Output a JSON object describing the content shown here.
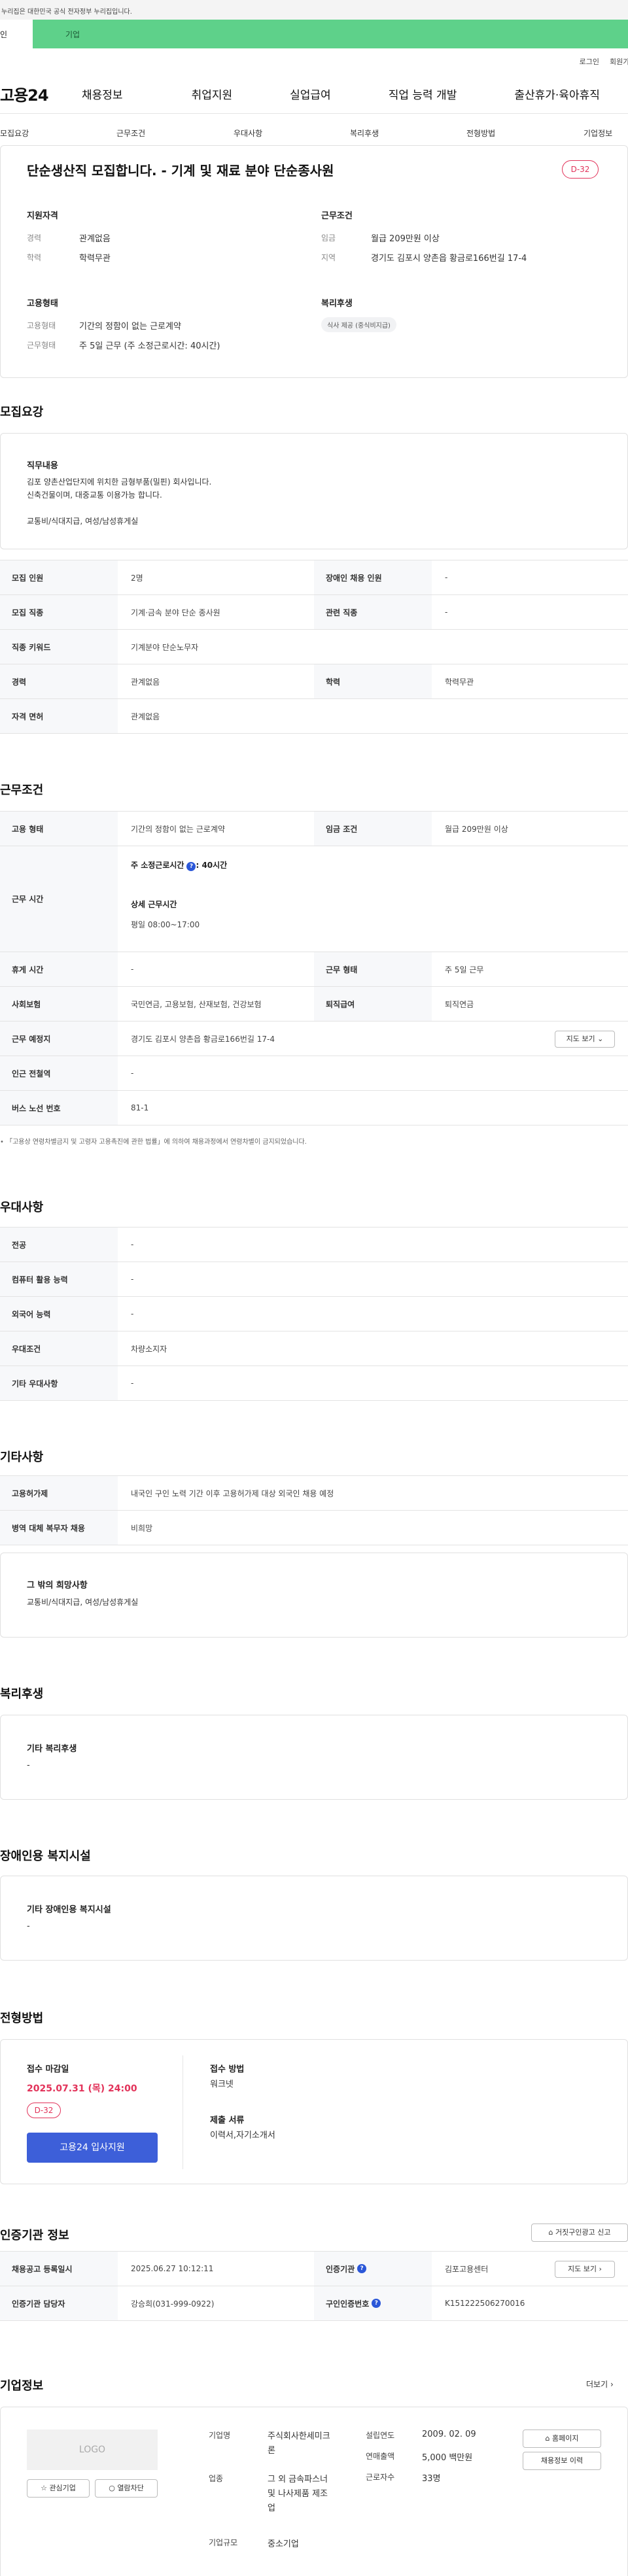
{
  "gov_notice": "누리집은 대한민국 공식 전자정부 누리집입니다.",
  "user_type": {
    "personal": "인",
    "company": "기업"
  },
  "util": {
    "login": "로그인",
    "join": "회원가"
  },
  "logo": "고용24",
  "gnb": [
    "채용정보",
    "취업지원",
    "실업급여",
    "직업 능력 개발",
    "출산휴가·육아휴직"
  ],
  "snb": [
    "모집요강",
    "근무조건",
    "우대사항",
    "복리후생",
    "전형방법",
    "기업정보"
  ],
  "title": {
    "text": "단순생산직 모집합니다. - 기계 및 재료 분야 단순종사원",
    "dday": "D-32"
  },
  "summary": {
    "qual_title": "지원자격",
    "qual": [
      {
        "k": "경력",
        "v": "관계없음"
      },
      {
        "k": "학력",
        "v": "학력무관"
      }
    ],
    "cond_title": "근무조건",
    "cond": [
      {
        "k": "임금",
        "v": "월급 209만원 이상"
      },
      {
        "k": "지역",
        "v": "경기도 김포시 양촌읍 황금로166번길 17-4"
      }
    ],
    "emp_title": "고용형태",
    "emp": [
      {
        "k": "고용형태",
        "v": "기간의 정함이 없는 근로계약"
      },
      {
        "k": "근무형태",
        "v": "주 5일 근무 (주 소정근로시간: 40시간)"
      }
    ],
    "welfare_title": "복리후생",
    "welfare_chip": "식사 제공 (중식비지급)"
  },
  "recruit": {
    "section_title": "모집요강",
    "duty_title": "직무내용",
    "duty_lines": [
      "김포 양촌산업단지에 위치한 금형부품(밀핀) 회사입니다.",
      "신축건물이며, 대중교통 이용가능 합니다.",
      "",
      "교통비/식대지급, 여성/남성휴게실"
    ],
    "rows": [
      [
        "모집 인원",
        "2명",
        "장애인 채용 인원",
        "-"
      ],
      [
        "모집 직종",
        "기계·금속 분야 단순 종사원",
        "관련 직종",
        "-"
      ],
      [
        "직종 키워드",
        "기계분야 단순노무자",
        "",
        ""
      ],
      [
        "경력",
        "관계없음",
        "학력",
        "학력무관"
      ],
      [
        "자격 면허",
        "관계없음",
        "",
        ""
      ]
    ]
  },
  "work": {
    "section_title": "근무조건",
    "r1": [
      "고용 형태",
      "기간의 정함이 없는 근로계약",
      "임금 조건",
      "월급 209만원 이상"
    ],
    "hours_label": "근무 시간",
    "hours_main": "주 소정근로시간",
    "hours_val": ": 40시간",
    "hours_detail_title": "상세 근무시간",
    "hours_detail": "평일 08:00~17:00",
    "r3": [
      "휴게 시간",
      "-",
      "근무 형태",
      "주 5일 근무"
    ],
    "r4": [
      "사회보험",
      "국민연금, 고용보험, 산재보험, 건강보험",
      "퇴직급여",
      "퇴직연금"
    ],
    "r5": [
      "근무 예정지",
      "경기도 김포시 양촌읍 황금로166번길 17-4"
    ],
    "map_btn": "지도 보기",
    "r6": [
      "인근 전철역",
      "-"
    ],
    "r7": [
      "버스 노선 번호",
      "81-1"
    ],
    "note": "「고용상 연령차별금지 및 고령자 고용촉진에 관한 법률」에 의하여 채용과정에서 연령차별이 금지되었습니다."
  },
  "pref": {
    "section_title": "우대사항",
    "rows": [
      [
        "전공",
        "-"
      ],
      [
        "컴퓨터 활용 능력",
        "-"
      ],
      [
        "외국어 능력",
        "-"
      ],
      [
        "우대조건",
        "차량소지자"
      ],
      [
        "기타 우대사항",
        "-"
      ]
    ]
  },
  "etc": {
    "section_title": "기타사항",
    "rows": [
      [
        "고용허가제",
        "내국인 구인 노력 기간 이후 고용허가제 대상 외국인 채용 예정"
      ],
      [
        "병역 대체 복무자 채용",
        "비희망"
      ]
    ],
    "wish_title": "그 밖의 희망사항",
    "wish_text": "교통비/식대지급, 여성/남성휴게실"
  },
  "welfare": {
    "section_title": "복리후생",
    "box_title": "기타 복리후생",
    "box_text": "-"
  },
  "disabled": {
    "section_title": "장애인용 복지시설",
    "box_title": "기타 장애인용 복지시설",
    "box_text": "-"
  },
  "selection": {
    "section_title": "전형방법",
    "deadline_title": "접수 마감일",
    "deadline": "2025.07.31 (목) 24:00",
    "dday": "D-32",
    "apply_btn": "고용24 입사지원",
    "method_title": "접수 방법",
    "method": "워크넷",
    "docs_title": "제출 서류",
    "docs": "이력서,자기소개서"
  },
  "cert": {
    "section_title": "인증기관 정보",
    "report_btn": "거짓구인광고 신고",
    "r1": [
      "채용공고 등록일시",
      "2025.06.27 10:12:11",
      "인증기관",
      "김포고용센터"
    ],
    "map_btn": "지도 보기",
    "r2": [
      "인증기관 담당자",
      "강승희(031-999-0922)",
      "구인인증번호",
      "K151222506270016"
    ]
  },
  "company": {
    "section_title": "기업정보",
    "more": "더보기",
    "logo_text": "LOGO",
    "fav_btn": "관심기업",
    "block_btn": "열람차단",
    "name_k": "기업명",
    "name_v": [
      "주식회사한세미크",
      "론"
    ],
    "industry_k": "업종",
    "industry_v": [
      "그 외 금속파스너",
      "및 나사제품 제조",
      "업"
    ],
    "size_k": "기업규모",
    "size_v": "중소기업",
    "founded_k": "설립연도",
    "founded_v": "2009. 02. 09",
    "revenue_k": "연매출액",
    "revenue_v": "5,000 백만원",
    "employees_k": "근로자수",
    "employees_v": "33명",
    "home_btn": "홈페이지",
    "jobs_btn": "채용정보 이력"
  }
}
